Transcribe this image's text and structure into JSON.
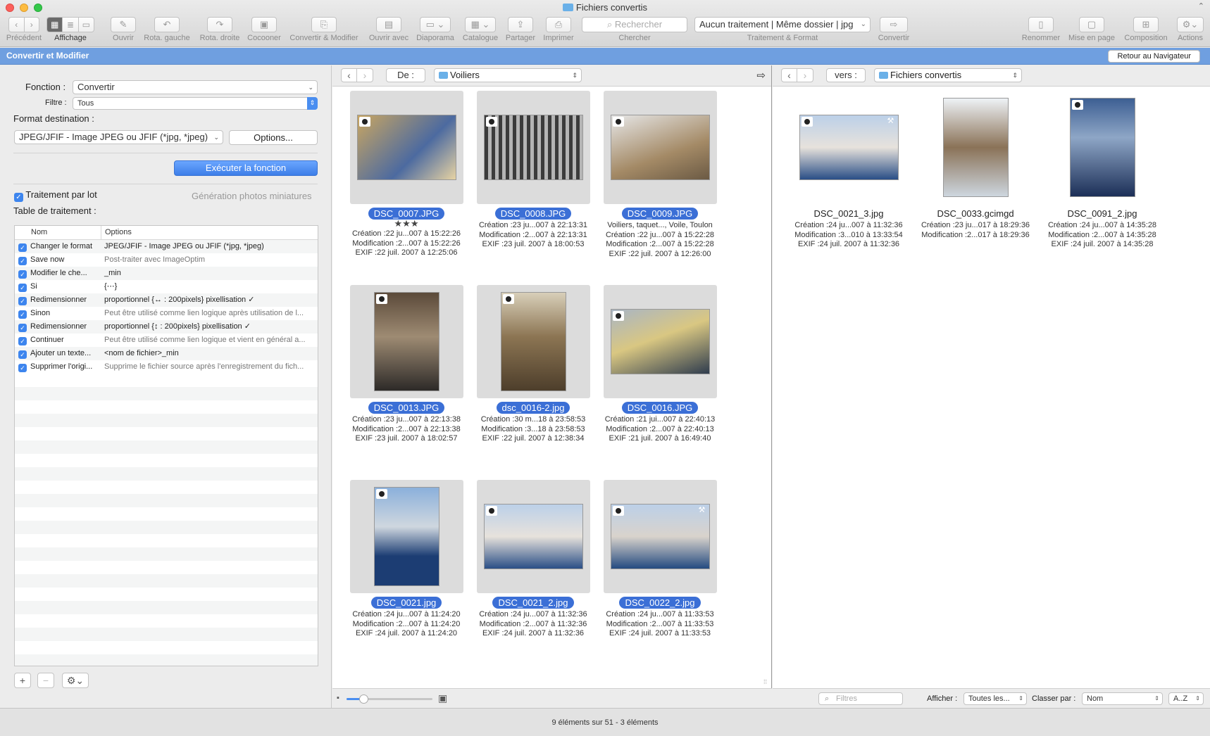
{
  "window": {
    "title": "Fichiers convertis"
  },
  "toolbar": {
    "back_label": "Précédent",
    "view_label": "Affichage",
    "open_label": "Ouvrir",
    "rot_left_label": "Rota. gauche",
    "rot_right_label": "Rota. droite",
    "cocoon_label": "Cocooner",
    "convert_modify_label": "Convertir & Modifier",
    "open_with_label": "Ouvrir avec",
    "slideshow_label": "Diaporama",
    "catalog_label": "Catalogue",
    "share_label": "Partager",
    "print_label": "Imprimer",
    "search_placeholder": "Rechercher",
    "search_label": "Chercher",
    "process_value": "Aucun traitement | Même dossier | jpg",
    "process_label": "Traitement & Format",
    "convert_label": "Convertir",
    "rename_label": "Renommer",
    "layout_label": "Mise en page",
    "composition_label": "Composition",
    "actions_label": "Actions"
  },
  "header": {
    "title": "Convertir et Modifier",
    "back_to_browser": "Retour au Navigateur"
  },
  "left": {
    "function_label": "Fonction :",
    "function_value": "Convertir",
    "filter_label": "Filtre :",
    "filter_value": "Tous",
    "dest_format_label": "Format destination :",
    "dest_format_value": "JPEG/JFIF - Image JPEG ou JFIF (*jpg, *jpeg)",
    "options_button": "Options...",
    "execute_button": "Exécuter la fonction",
    "batch_label": "Traitement par lot",
    "thumbs_label": "Génération photos miniatures",
    "table_label": "Table de traitement :",
    "col_name": "Nom",
    "col_options": "Options",
    "rows": [
      {
        "name": "Changer le format",
        "options": "JPEG/JFIF - Image JPEG ou JFIF (*jpg, *jpeg)",
        "dim": false
      },
      {
        "name": "Save now",
        "options": "Post-traiter avec ImageOptim",
        "dim": true
      },
      {
        "name": "Modifier le che...",
        "options": "_min",
        "dim": false
      },
      {
        "name": "Si",
        "options": "{⋯}",
        "dim": false
      },
      {
        "name": "Redimensionner",
        "options": "proportionnel {↔ : 200pixels}   pixellisation ✓",
        "dim": false
      },
      {
        "name": "Sinon",
        "options": "Peut être utilisé comme lien logique après utilisation de l...",
        "dim": true
      },
      {
        "name": "Redimensionner",
        "options": "proportionnel {↕ : 200pixels}   pixellisation ✓",
        "dim": false
      },
      {
        "name": "Continuer",
        "options": "Peut être utilisé comme lien logique et vient en général a...",
        "dim": true
      },
      {
        "name": "Ajouter un texte...",
        "options": "<nom de fichier>_min",
        "dim": false
      },
      {
        "name": "Supprimer l'origi...",
        "options": "Supprime le fichier source après l'enregistrement du fich...",
        "dim": true
      }
    ],
    "add_button": "+",
    "remove_button": "−"
  },
  "source": {
    "from_label": "De :",
    "folder": "Voiliers",
    "items": [
      {
        "name": "DSC_0007.JPG",
        "stars": "★★★",
        "lines": [
          "Création :22 ju...007 à 15:22:26",
          "Modification :2...007 à 15:22:26",
          "EXIF :22 juil. 2007 à 12:25:06"
        ]
      },
      {
        "name": "DSC_0008.JPG",
        "stars": "",
        "lines": [
          "Création :23 ju...007 à 22:13:31",
          "Modification :2...007 à 22:13:31",
          "EXIF :23 juil. 2007 à 18:00:53"
        ]
      },
      {
        "name": "DSC_0009.JPG",
        "stars": "",
        "lines": [
          "Voiliers, taquet..., Voile, Toulon",
          "Création :22 ju...007 à 15:22:28",
          "Modification :2...007 à 15:22:28",
          "EXIF :22 juil. 2007 à 12:26:00"
        ]
      },
      {
        "name": "DSC_0013.JPG",
        "stars": "",
        "lines": [
          "Création :23 ju...007 à 22:13:38",
          "Modification :2...007 à 22:13:38",
          "EXIF :23 juil. 2007 à 18:02:57"
        ]
      },
      {
        "name": "dsc_0016-2.jpg",
        "stars": "",
        "lines": [
          "Création :30 m...18 à 23:58:53",
          "Modification :3...18 à 23:58:53",
          "EXIF :22 juil. 2007 à 12:38:34"
        ]
      },
      {
        "name": "DSC_0016.JPG",
        "stars": "",
        "lines": [
          "Création :21 jui...007 à 22:40:13",
          "Modification :2...007 à 22:40:13",
          "EXIF :21 juil. 2007 à 16:49:40"
        ]
      },
      {
        "name": "DSC_0021.jpg",
        "stars": "",
        "lines": [
          "Création :24 ju...007 à 11:24:20",
          "Modification :2...007 à 11:24:20",
          "EXIF :24 juil. 2007 à 11:24:20"
        ]
      },
      {
        "name": "DSC_0021_2.jpg",
        "stars": "",
        "lines": [
          "Création :24 ju...007 à 11:32:36",
          "Modification :2...007 à 11:32:36",
          "EXIF :24 juil. 2007 à 11:32:36"
        ]
      },
      {
        "name": "DSC_0022_2.jpg",
        "stars": "",
        "lines": [
          "Création :24 ju...007 à 11:33:53",
          "Modification :2...007 à 11:33:53",
          "EXIF :24 juil. 2007 à 11:33:53"
        ]
      }
    ]
  },
  "dest": {
    "to_label": "vers :",
    "folder": "Fichiers convertis",
    "items": [
      {
        "name": "DSC_0021_3.jpg",
        "lines": [
          "Création :24 ju...007 à 11:32:36",
          "Modification :3...010 à 13:33:54",
          "EXIF :24 juil. 2007 à 11:32:36"
        ]
      },
      {
        "name": "DSC_0033.gcimgd",
        "lines": [
          "Création :23 ju...017 à 18:29:36",
          "Modification :2...017 à 18:29:36"
        ]
      },
      {
        "name": "DSC_0091_2.jpg",
        "lines": [
          "Création :24 ju...007 à 14:35:28",
          "Modification :2...007 à 14:35:28",
          "EXIF :24 juil. 2007 à 14:35:28"
        ]
      }
    ]
  },
  "footer": {
    "filter_placeholder": "Filtres",
    "show_label": "Afficher :",
    "show_value": "Toutes les...",
    "sort_label": "Classer par :",
    "sort_value": "Nom",
    "order_value": "A..Z",
    "zoom_level": 0.2
  },
  "status": {
    "text": "9 éléments sur 51 - 3 éléments"
  },
  "colors": {
    "accent": "#3b6fd6",
    "header": "#6f9fe0"
  }
}
